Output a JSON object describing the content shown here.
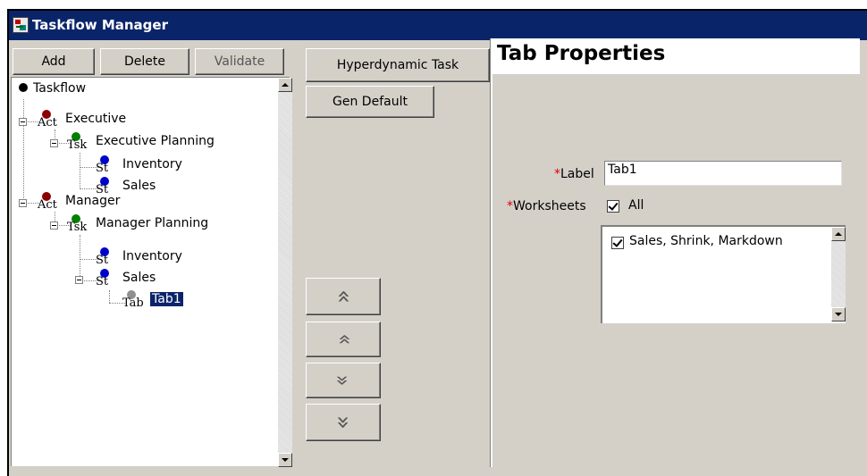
{
  "window": {
    "title": "Taskflow Manager"
  },
  "toolbar": {
    "add": "Add",
    "delete": "Delete",
    "validate": "Validate",
    "hyperdynamic": "Hyperdynamic Task",
    "gen_default": "Gen Default"
  },
  "tree": {
    "root": "Taskflow",
    "executive": {
      "icon": "Act",
      "label": "Executive"
    },
    "executive_planning": {
      "icon": "Tsk",
      "label": "Executive Planning"
    },
    "exec_inventory": {
      "icon": "St",
      "label": "Inventory"
    },
    "exec_sales": {
      "icon": "St",
      "label": "Sales"
    },
    "manager": {
      "icon": "Act",
      "label": "Manager"
    },
    "manager_planning": {
      "icon": "Tsk",
      "label": "Manager Planning"
    },
    "mgr_inventory": {
      "icon": "St",
      "label": "Inventory"
    },
    "mgr_sales": {
      "icon": "St",
      "label": "Sales"
    },
    "tab1": {
      "icon": "Tab",
      "label": "Tab1"
    }
  },
  "move_buttons": {
    "top": "»",
    "up": "»",
    "down": "»",
    "bottom": "»"
  },
  "properties": {
    "title": "Tab Properties",
    "label_field": {
      "required": "*",
      "label": "Label",
      "value": "Tab1"
    },
    "worksheets_field": {
      "required": "*",
      "label": "Worksheets",
      "all_label": "All",
      "all_checked": true
    },
    "worksheet_items": [
      {
        "label": "Sales, Shrink, Markdown",
        "checked": true
      }
    ]
  },
  "colors": {
    "title_bar": "#0a246a",
    "selection": "#0a246a",
    "act_ball": "#8b0000",
    "tsk_ball": "#008000",
    "st_ball": "#0000cc",
    "tab_ball": "#909090",
    "required": "#e00000"
  }
}
